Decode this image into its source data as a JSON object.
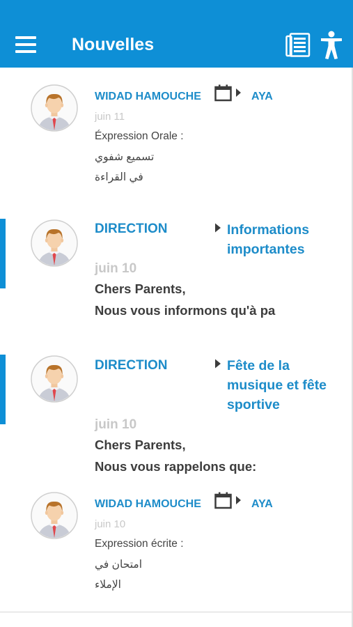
{
  "app_bar": {
    "title": "Nouvelles",
    "color": "#0e8fd6",
    "icons": [
      "menu-icon",
      "newspaper-icon",
      "accessibility-icon"
    ]
  },
  "news": [
    {
      "sender": "WIDAD HAMOUCHE",
      "target_icon": "calendar-icon",
      "target": "AYA",
      "date": "juin 11",
      "lines": [
        "Éxpression Orale :",
        "تسميع شفوي",
        "في القراءة"
      ],
      "unread": false
    },
    {
      "sender": "DIRECTION",
      "target": "Informations importantes",
      "target_lines": [
        "Informations",
        "importantes"
      ],
      "date": "juin 10",
      "lines": [
        "Chers Parents,",
        "Nous vous informons qu'à pa"
      ],
      "unread": true
    },
    {
      "sender": "DIRECTION",
      "target": "Fête de la musique et fête sportive",
      "target_lines": [
        "Fête de la",
        "musique et fête",
        "sportive"
      ],
      "date": "juin 10",
      "lines": [
        "Chers Parents,",
        "Nous vous rappelons que:"
      ],
      "unread": true
    },
    {
      "sender": "WIDAD HAMOUCHE",
      "target_icon": "calendar-icon",
      "target": "AYA",
      "date": "juin 10",
      "lines": [
        "Expression écrite :",
        "امتحان في",
        "الإملاء"
      ],
      "unread": false
    }
  ]
}
